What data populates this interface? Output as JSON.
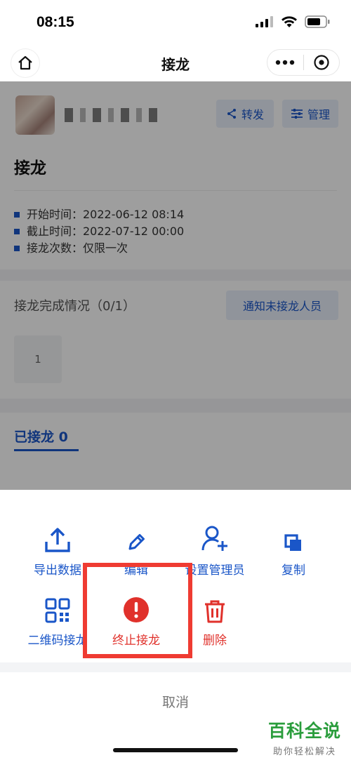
{
  "status_bar": {
    "time": "08:15"
  },
  "nav": {
    "title": "接龙"
  },
  "header": {
    "share_label": "转发",
    "manage_label": "管理"
  },
  "jielong": {
    "title": "接龙",
    "info": [
      {
        "label": "开始时间：2022-06-12 08:14"
      },
      {
        "label": "截止时间：2022-07-12 00:00"
      },
      {
        "label": "接龙次数：仅限一次"
      }
    ]
  },
  "progress": {
    "label": "接龙完成情况（0/1）",
    "notify_label": "通知未接龙人员",
    "tile_number": "1"
  },
  "tabs": {
    "done_label": "已接龙 0"
  },
  "actions": {
    "export": "导出数据",
    "edit": "编辑",
    "set_admin": "设置管理员",
    "copy": "复制",
    "qrcode": "二维码接龙",
    "stop": "终止接龙",
    "delete": "删除"
  },
  "cancel_label": "取消",
  "watermark": {
    "main": "百科全说",
    "sub": "助你轻松解决"
  },
  "colors": {
    "accent": "#1a56c8",
    "danger": "#e0312b",
    "highlight": "#ef3b32",
    "watermark": "#2a9d3c"
  }
}
